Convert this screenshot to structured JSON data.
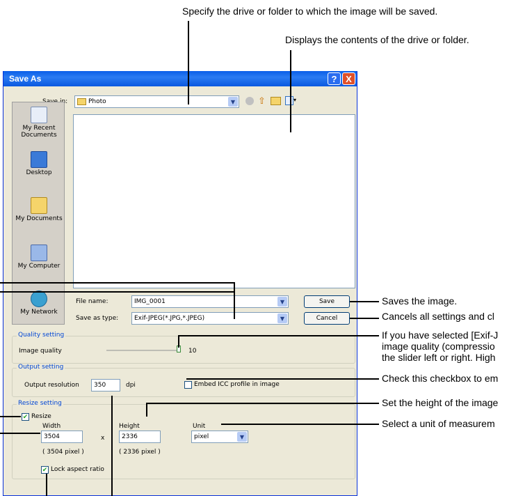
{
  "callouts": {
    "save_in": "Specify the drive or folder to which the image will be saved.",
    "contents": "Displays the contents of the drive or folder.",
    "save": "Saves the image.",
    "cancel": "Cancels all settings and cl",
    "quality_1": "If you have selected [Exif-J",
    "quality_2": "image quality (compressio",
    "quality_3": "the slider left or right. High",
    "embed": "Check this checkbox to em",
    "height": "Set the height of the image",
    "unit": "Select a unit of measurem"
  },
  "dialog": {
    "title": "Save As",
    "help_button": "?",
    "close_button": "X",
    "save_in_label": "Save in:",
    "save_in_value": "Photo",
    "places": [
      "My Recent Documents",
      "Desktop",
      "My Documents",
      "My Computer",
      "My Network"
    ],
    "file_name_label": "File name:",
    "file_name_value": "IMG_0001",
    "save_as_type_label": "Save as type:",
    "save_as_type_value": "Exif-JPEG(*.JPG,*.JPEG)",
    "save_button": "Save",
    "cancel_button": "Cancel",
    "quality": {
      "group_title": "Quality setting",
      "label": "Image quality",
      "value": "10",
      "slider_level": 1.0
    },
    "output": {
      "group_title": "Output setting",
      "resolution_label": "Output resolution",
      "resolution_value": "350",
      "resolution_unit": "dpi",
      "embed_label": "Embed ICC profile in image",
      "embed_checked": false
    },
    "resize": {
      "group_title": "Resize setting",
      "resize_label": "Resize",
      "resize_checked": true,
      "width_label": "Width",
      "width_value": "3504",
      "times": "x",
      "height_label": "Height",
      "height_value": "2336",
      "unit_label": "Unit",
      "unit_value": "pixel",
      "width_pixels": "( 3504 pixel )",
      "height_pixels": "( 2336 pixel )",
      "lock_label": "Lock aspect ratio",
      "lock_checked": true
    }
  }
}
